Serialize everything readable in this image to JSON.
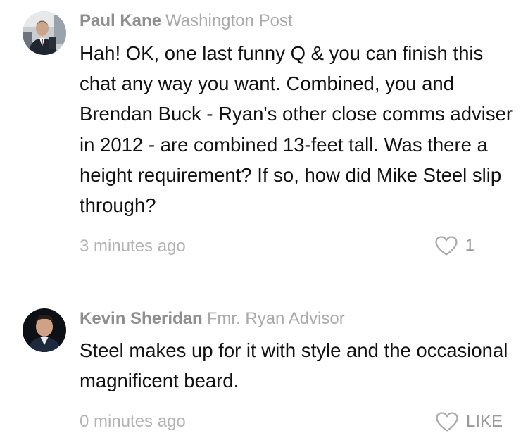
{
  "comments": [
    {
      "author": "Paul Kane",
      "affiliation": "Washington Post",
      "avatar_icon": "person-avatar-photo",
      "text": "Hah! OK, one last funny Q & you can finish this chat any way you want. Combined, you and Brendan Buck - Ryan's other close comms adviser in 2012 - are combined 13-feet tall. Was there a height requirement? If so, how did Mike Steel slip through?",
      "timestamp": "3 minutes ago",
      "like_icon": "heart-outline-icon",
      "like_label": "1"
    },
    {
      "author": "Kevin Sheridan",
      "affiliation": "Fmr. Ryan Advisor",
      "avatar_icon": "person-avatar-photo",
      "text": "Steel makes up for it with style and the occasional magnificent beard.",
      "timestamp": "0 minutes ago",
      "like_icon": "heart-outline-icon",
      "like_label": "LIKE"
    }
  ],
  "colors": {
    "meta_gray": "#b3b3b3",
    "author_gray": "#8e8e8e",
    "text": "#111111"
  }
}
